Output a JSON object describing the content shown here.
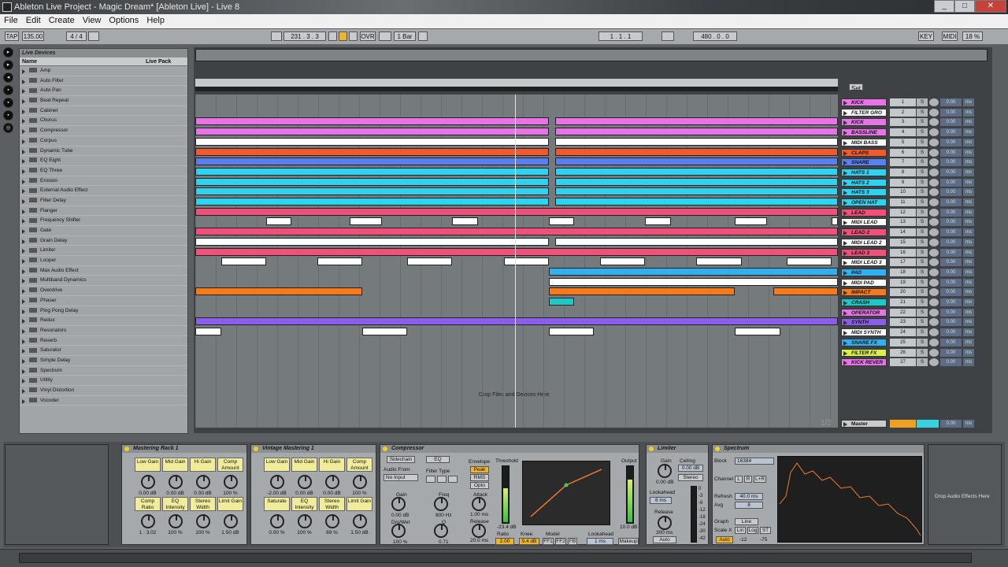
{
  "window": {
    "title": "Ableton Live Project - Magic Dream*  [Ableton Live] - Live 8",
    "min": "_",
    "max": "□",
    "close": "✕"
  },
  "menu": [
    "File",
    "Edit",
    "Create",
    "View",
    "Options",
    "Help"
  ],
  "transport": {
    "tap": "TAP",
    "tempo": "135.00",
    "sig": "4 / 4",
    "position": "231 .  3 .  3",
    "ovr": "OVR",
    "quant": "1 Bar",
    "loop_start": "1 .  1 .  1",
    "loop_len": "480 .  0 .  0",
    "key": "KEY",
    "midi": "MIDI",
    "cpu": "18 %"
  },
  "browser": {
    "header": "Live Devices",
    "col_name": "Name",
    "col_pack": "Live Pack",
    "devices": [
      "Amp",
      "Auto Filter",
      "Auto Pan",
      "Beat Repeat",
      "Cabinet",
      "Chorus",
      "Compressor",
      "Corpus",
      "Dynamic Tube",
      "EQ Eight",
      "EQ Three",
      "Erosion",
      "External Audio Effect",
      "Filter Delay",
      "Flanger",
      "Frequency Shifter",
      "Gate",
      "Grain Delay",
      "Limiter",
      "Looper",
      "Max Audio Effect",
      "Multiband Dynamics",
      "Overdrive",
      "Phaser",
      "Ping Pong Delay",
      "Redux",
      "Resonators",
      "Reverb",
      "Saturator",
      "Simple Delay",
      "Spectrum",
      "Utility",
      "Vinyl Distortion",
      "Vocoder"
    ]
  },
  "arrangement": {
    "drop_text": "Drop Files and Devices Here",
    "set_label": "Set",
    "page": "1/2",
    "master": "Master"
  },
  "tracks": [
    {
      "name": "KICK",
      "num": "1",
      "color": "#e873e6"
    },
    {
      "name": "FILTER GRO",
      "num": "2",
      "color": "#ffffff"
    },
    {
      "name": "KICK",
      "num": "3",
      "color": "#e873e6"
    },
    {
      "name": "BASSLINE",
      "num": "4",
      "color": "#e873e6"
    },
    {
      "name": "MIDI BASS",
      "num": "5",
      "color": "#ffffff"
    },
    {
      "name": "CLAPS",
      "num": "6",
      "color": "#f05a2c"
    },
    {
      "name": "SNARE",
      "num": "7",
      "color": "#5a7ff0"
    },
    {
      "name": "HATS 1",
      "num": "8",
      "color": "#2fd3f2"
    },
    {
      "name": "HATS 2",
      "num": "9",
      "color": "#2fd3f2"
    },
    {
      "name": "HATS 3",
      "num": "10",
      "color": "#2fd3f2"
    },
    {
      "name": "OPEN HAT",
      "num": "11",
      "color": "#2fd3f2"
    },
    {
      "name": "LEAD",
      "num": "12",
      "color": "#f0507a"
    },
    {
      "name": "MIDI LEAD",
      "num": "13",
      "color": "#ffffff"
    },
    {
      "name": "LEAD 2",
      "num": "14",
      "color": "#f0507a"
    },
    {
      "name": "MIDI LEAD 2",
      "num": "15",
      "color": "#ffffff"
    },
    {
      "name": "LEAD 3",
      "num": "16",
      "color": "#f0507a"
    },
    {
      "name": "MIDI LEAD 3",
      "num": "17",
      "color": "#ffffff"
    },
    {
      "name": "PAD",
      "num": "18",
      "color": "#30b0f0"
    },
    {
      "name": "MIDI PAD",
      "num": "19",
      "color": "#ffffff"
    },
    {
      "name": "IMPACT",
      "num": "20",
      "color": "#f57a1c"
    },
    {
      "name": "CRASH",
      "num": "21",
      "color": "#1ec8c8"
    },
    {
      "name": "OPERATOR",
      "num": "22",
      "color": "#e873e6"
    },
    {
      "name": "SYNTH",
      "num": "23",
      "color": "#8a5ee8"
    },
    {
      "name": "MIDI SYNTH",
      "num": "24",
      "color": "#ffffff"
    },
    {
      "name": "SNARE FX",
      "num": "25",
      "color": "#30b0f0"
    },
    {
      "name": "FILTER FX",
      "num": "26",
      "color": "#d8f048"
    },
    {
      "name": "KICK REVER",
      "num": "27",
      "color": "#e873e6"
    }
  ],
  "track_ctrl": {
    "solo": "S",
    "vol": "0.00",
    "ms": "ms",
    "dash": "-",
    "sub_val": "0",
    "sub_c": "C"
  },
  "devices": {
    "rack1": {
      "title": "Mastering Rack 1",
      "macros": [
        {
          "label": "Low Gain",
          "val": "0.00 dB"
        },
        {
          "label": "Mid Gain",
          "val": "0.00 dB"
        },
        {
          "label": "Hi Gain",
          "val": "0.00 dB"
        },
        {
          "label": "Comp Amount",
          "val": "100 %"
        },
        {
          "label": "Comp Ratio",
          "val": "1 : 3.02"
        },
        {
          "label": "EQ Intensity",
          "val": "100 %"
        },
        {
          "label": "Stereo Width",
          "val": "100 %"
        },
        {
          "label": "Limit Gain",
          "val": "1.50 dB"
        }
      ]
    },
    "rack2": {
      "title": "Vintage Mastering 1",
      "macros": [
        {
          "label": "Low Gain",
          "val": "-2.00 dB"
        },
        {
          "label": "Mid Gain",
          "val": "0.00 dB"
        },
        {
          "label": "Hi Gain",
          "val": "0.00 dB"
        },
        {
          "label": "Comp Amount",
          "val": "100 %"
        },
        {
          "label": "Saturate",
          "val": "0.00 %"
        },
        {
          "label": "EQ Intensity",
          "val": "100 %"
        },
        {
          "label": "Stereo Width",
          "val": "69 %"
        },
        {
          "label": "Limit Gain",
          "val": "1.50 dB"
        }
      ]
    },
    "comp": {
      "title": "Compressor",
      "sidechain": "Sidechain",
      "eq": "EQ",
      "audio_from": "Audio From",
      "no_input": "No Input",
      "gain": "Gain",
      "gain_val": "0.00 dB",
      "drywet": "Dry/Wet",
      "drywet_val": "100 %",
      "filter_type": "Filter Type",
      "freq": "Freq",
      "freq_val": "800 Hz",
      "q": "Q",
      "q_val": "0.71",
      "envelope": "Envelope",
      "peak": "Peak",
      "rms": "RMS",
      "opto": "Opto",
      "attack": "Attack",
      "attack_val": "1.00 ms",
      "release": "Release",
      "release_val": "20.0 ms",
      "threshold": "Threshold",
      "threshold_val": "-23.4 dB",
      "ratio": "Ratio",
      "ratio_val": "2.00",
      "knee": "Knee",
      "knee_val": "9.4 dB",
      "model": "Model",
      "ff1": "FF1",
      "ff2": "FF2",
      "fb": "FB",
      "lookahead": "Lookahead",
      "lookahead_val": "1 ms",
      "output": "Output",
      "output_val": "10.0 dB",
      "makeup": "Makeup"
    },
    "limiter": {
      "title": "Limiter",
      "gain": "Gain",
      "gain_val": "0.00 dB",
      "ceiling": "Ceiling",
      "ceiling_val": "0.00 dB",
      "stereo": "Stereo",
      "lookahead": "Lookahead",
      "lookahead_val": "6 ms",
      "release": "Release",
      "release_val": "300 ms",
      "auto": "Auto",
      "scale": [
        "0",
        "-3",
        "-6",
        "-12",
        "-18",
        "-24",
        "-30",
        "-42"
      ]
    },
    "spectrum": {
      "title": "Spectrum",
      "block": "Block",
      "block_val": "16384",
      "channel": "Channel",
      "l": "L",
      "r": "R",
      "lr": "L+R",
      "refresh": "Refresh",
      "refresh_val": "40.0 ms",
      "avg": "Avg",
      "avg_val": "8",
      "graph": "Graph",
      "line": "Line",
      "scalex": "Scale X",
      "lin": "Lin",
      "log": "Log",
      "st": "ST",
      "auto": "Auto",
      "range1": "-12",
      "range2": "-75"
    },
    "drop": "Drop Audio Effects Here"
  }
}
